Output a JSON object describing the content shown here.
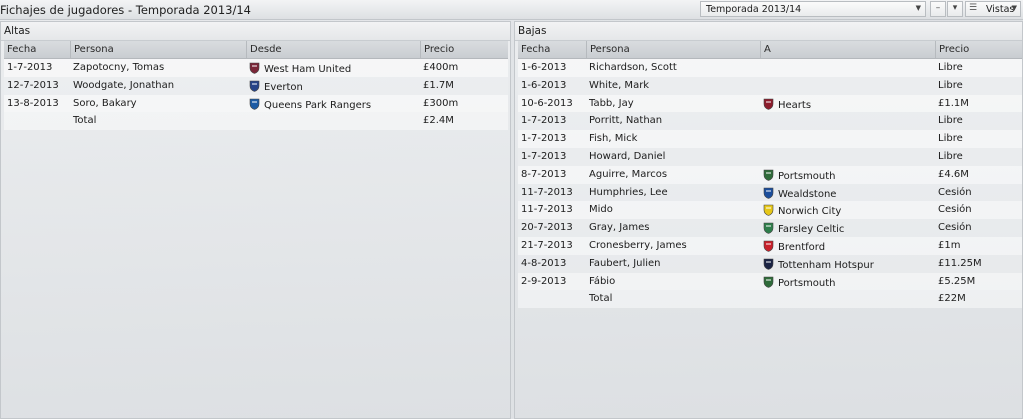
{
  "header": {
    "title": "Fichajes de jugadores - Temporada 2013/14",
    "season_select": "Temporada 2013/14",
    "prev_label": "–",
    "next_label": "▾",
    "views_label": "Vistas"
  },
  "altas": {
    "title": "Altas",
    "columns": [
      "Fecha",
      "Persona",
      "Desde",
      "Precio"
    ],
    "rows": [
      {
        "fecha": "1-7-2013",
        "persona": "Zapotocny, Tomas",
        "club": "West Ham United",
        "precio": "£400m",
        "crest": "westham-crest-icon",
        "color": "#7a2638"
      },
      {
        "fecha": "12-7-2013",
        "persona": "Woodgate, Jonathan",
        "club": "Everton",
        "precio": "£1.7M",
        "crest": "everton-crest-icon",
        "color": "#274488"
      },
      {
        "fecha": "13-8-2013",
        "persona": "Soro, Bakary",
        "club": "Queens Park Rangers",
        "precio": "£300m",
        "crest": "qpr-crest-icon",
        "color": "#1d5ba4"
      }
    ],
    "total_label": "Total",
    "total_value": "£2.4M"
  },
  "bajas": {
    "title": "Bajas",
    "columns": [
      "Fecha",
      "Persona",
      "A",
      "Precio"
    ],
    "rows": [
      {
        "fecha": "1-6-2013",
        "persona": "Richardson, Scott",
        "club": "",
        "precio": "Libre",
        "crest": "",
        "color": ""
      },
      {
        "fecha": "1-6-2013",
        "persona": "White, Mark",
        "club": "",
        "precio": "Libre",
        "crest": "",
        "color": ""
      },
      {
        "fecha": "10-6-2013",
        "persona": "Tabb, Jay",
        "club": "Hearts",
        "precio": "£1.1M",
        "crest": "hearts-crest-icon",
        "color": "#8c1c2c"
      },
      {
        "fecha": "1-7-2013",
        "persona": "Porritt, Nathan",
        "club": "",
        "precio": "Libre",
        "crest": "",
        "color": ""
      },
      {
        "fecha": "1-7-2013",
        "persona": "Fish, Mick",
        "club": "",
        "precio": "Libre",
        "crest": "",
        "color": ""
      },
      {
        "fecha": "1-7-2013",
        "persona": "Howard, Daniel",
        "club": "",
        "precio": "Libre",
        "crest": "",
        "color": ""
      },
      {
        "fecha": "8-7-2013",
        "persona": "Aguirre, Marcos",
        "club": "Portsmouth",
        "precio": "£4.6M",
        "crest": "portsmouth-crest-icon",
        "color": "#2f6b3a"
      },
      {
        "fecha": "11-7-2013",
        "persona": "Humphries, Lee",
        "club": "Wealdstone",
        "precio": "Cesión",
        "crest": "wealdstone-crest-icon",
        "color": "#1b4d9b"
      },
      {
        "fecha": "11-7-2013",
        "persona": "Mido",
        "club": "Norwich City",
        "precio": "Cesión",
        "crest": "norwich-crest-icon",
        "color": "#e6c718"
      },
      {
        "fecha": "20-7-2013",
        "persona": "Gray, James",
        "club": "Farsley Celtic",
        "precio": "Cesión",
        "crest": "farsley-crest-icon",
        "color": "#2d7d4a"
      },
      {
        "fecha": "21-7-2013",
        "persona": "Cronesberry, James",
        "club": "Brentford",
        "precio": "£1m",
        "crest": "brentford-crest-icon",
        "color": "#c8202a"
      },
      {
        "fecha": "4-8-2013",
        "persona": "Faubert, Julien",
        "club": "Tottenham Hotspur",
        "precio": "£11.25M",
        "crest": "tottenham-crest-icon",
        "color": "#1a2344"
      },
      {
        "fecha": "2-9-2013",
        "persona": "Fábio",
        "club": "Portsmouth",
        "precio": "£5.25M",
        "crest": "portsmouth-crest-icon",
        "color": "#2f6b3a"
      }
    ],
    "total_label": "Total",
    "total_value": "£22M"
  }
}
